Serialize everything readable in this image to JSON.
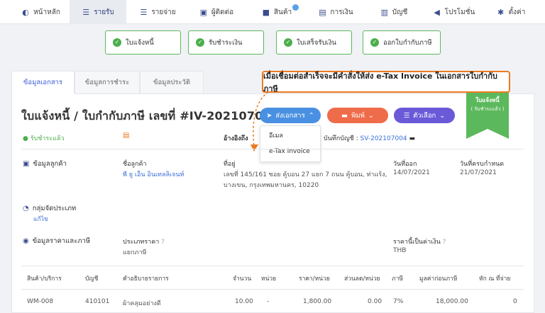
{
  "nav": [
    {
      "label": "หน้าหลัก",
      "icon": "palette-icon"
    },
    {
      "label": "รายรับ",
      "icon": "sliders-icon",
      "active": true
    },
    {
      "label": "รายจ่าย",
      "icon": "sliders-icon"
    },
    {
      "label": "ผู้ติดต่อ",
      "icon": "contact-card-icon"
    },
    {
      "label": "สินค้า",
      "icon": "box-icon"
    },
    {
      "label": "การเงิน",
      "icon": "money-icon"
    },
    {
      "label": "บัญชี",
      "icon": "ledger-icon"
    },
    {
      "label": "โปรโมชั่น",
      "icon": "megaphone-icon"
    },
    {
      "label": "ตั้งค่า",
      "icon": "gear-icon"
    }
  ],
  "status_steps": [
    "ใบแจ้งหนี้",
    "รับชำระเงิน",
    "ใบเสร็จรับเงิน",
    "ออกใบกำกับภาษี"
  ],
  "tabs": [
    "ข้อมูลเอกสาร",
    "ข้อมูลการชำระ",
    "ข้อมูลประวัติ"
  ],
  "callout": "เมื่อเชื่อมต่อสำเร็จจะมีคำสั่งให้ส่ง e-Tax Invoice ในเอกสารใบกำกับภาษี",
  "title": "ใบแจ้งหนี้ / ใบกำกับภาษี เลขที่ #IV-20210700004",
  "buttons": {
    "send": "ส่งเอกสาร",
    "print": "พิมพ์",
    "options": "ตัวเลือก"
  },
  "dropdown": [
    "อีเมล",
    "e-Tax Invoice"
  ],
  "ribbon": {
    "line1": "ใบแจ้งหนี้",
    "line2": "( รับชำระแล้ว )"
  },
  "status_text": "รับชำระแล้ว",
  "ref": {
    "label": "อ้างอิงถึง",
    "book_label": "บันทึกบัญชี :",
    "book_value": "SV-202107004"
  },
  "customer": {
    "section": "ข้อมูลลูกค้า",
    "name_label": "ชื่อลูกค้า",
    "name": "พี ยู เอ็น อินเทลลิเจนท์",
    "addr_label": "ที่อยู่",
    "addr1": "เลขที่ 145/161 ซอย คู้บอน 27 แยก 7 ถนน คู้บอน, ท่าแร้ง,",
    "addr2": "บางเขน, กรุงเทพมหานคร, 10220",
    "issue_label": "วันที่ออก",
    "issue": "14/07/2021",
    "due_label": "วันที่ครบกำหนด",
    "due": "21/07/2021"
  },
  "category": {
    "section": "กลุ่มจัดประเภท",
    "edit": "แก้ไข"
  },
  "pricing": {
    "section": "ข้อมูลราคาและภาษี",
    "type_label": "ประเภทราคา",
    "type": "แยกภาษี",
    "currency_label": "ราคานี้เป็นค่าเงิน",
    "currency": "THB"
  },
  "table": {
    "headers": [
      "สินค้า/บริการ",
      "บัญชี",
      "คำอธิบายรายการ",
      "จำนวน",
      "หน่วย",
      "ราคา/หน่วย",
      "ส่วนลด/หน่วย",
      "ภาษี",
      "มูลค่าก่อนภาษี",
      "หัก ณ ที่จ่าย"
    ],
    "row": [
      "WM-008",
      "410101",
      "ผ้าคลุมอย่างดี",
      "10.00",
      "-",
      "1,800.00",
      "0.00",
      "7%",
      "18,000.00",
      "0"
    ]
  },
  "colors": {
    "send": "#4a90e2",
    "print": "#ef6c4a",
    "options": "#6a5ad8",
    "ribbon": "#5cb85c",
    "callout_border": "#ef7a1f"
  }
}
